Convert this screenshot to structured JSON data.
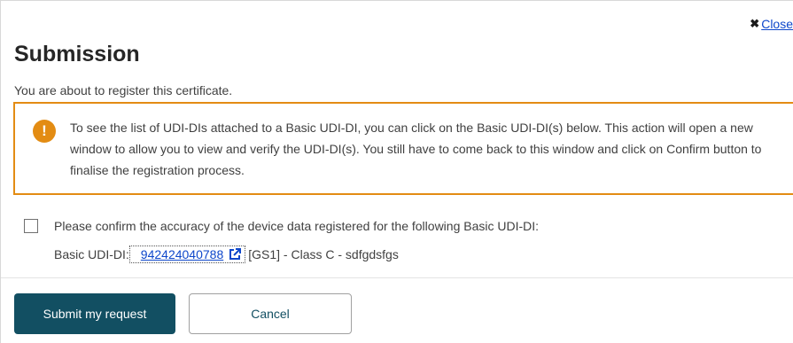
{
  "dialog": {
    "close_label": "Close",
    "title": "Submission",
    "intro": "You are about to register this certificate.",
    "warning_text": "To see the list of UDI-DIs attached to a Basic UDI-DI, you can click on the Basic UDI-DI(s) below. This action will open a new window to allow you to view and verify the UDI-DI(s). You still have to come back to this window and click on Confirm button to finalise the registration process.",
    "confirm_label": "Please confirm the accuracy of the device data registered for the following Basic UDI-DI:",
    "udi_prefix": "Basic UDI-DI:",
    "udi_value": "942424040788",
    "udi_details": "[GS1] - Class C - sdfgdsfgs",
    "submit_label": "Submit my request",
    "cancel_label": "Cancel"
  },
  "colors": {
    "primary": "#124f62",
    "warning": "#e38c13",
    "link": "#0e47cb"
  }
}
